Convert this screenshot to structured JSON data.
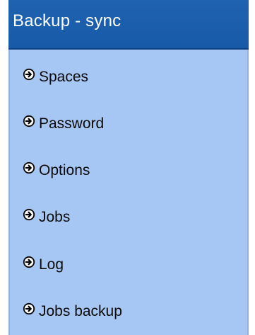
{
  "header": {
    "title": "Backup - sync"
  },
  "colors": {
    "header_bg": "#1f62b0",
    "menu_bg": "#a6c7f4",
    "text": "#0a0a0a"
  },
  "menu": {
    "items": [
      {
        "label": "Spaces",
        "icon": "arrow-right-circle-icon"
      },
      {
        "label": "Password",
        "icon": "arrow-right-circle-icon"
      },
      {
        "label": "Options",
        "icon": "arrow-right-circle-icon"
      },
      {
        "label": "Jobs",
        "icon": "arrow-right-circle-icon"
      },
      {
        "label": "Log",
        "icon": "arrow-right-circle-icon"
      },
      {
        "label": "Jobs backup",
        "icon": "arrow-right-circle-icon"
      }
    ]
  }
}
